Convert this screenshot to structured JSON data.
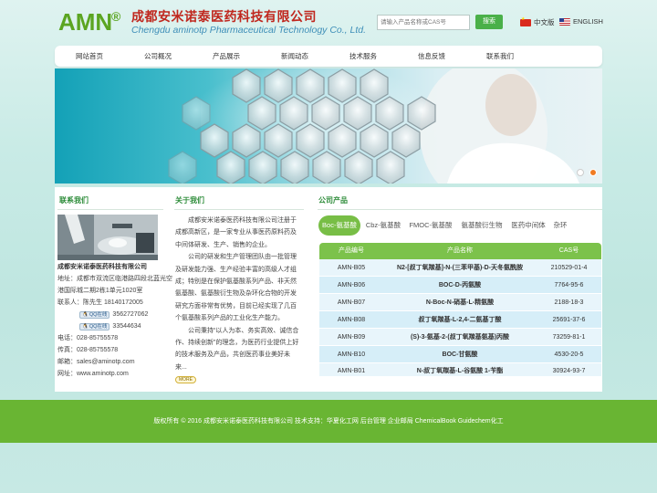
{
  "brand": {
    "logo_text": "AMN",
    "logo_mark": "®",
    "company_cn": "成都安米诺泰医药科技有限公司",
    "company_en": "Chengdu aminotp Pharmaceutical Technology Co., Ltd."
  },
  "search": {
    "placeholder": "请输入产品名称或CAS号",
    "button_label": "搜索"
  },
  "languages": [
    {
      "label": "中文版",
      "flag": "china-flag-icon"
    },
    {
      "label": "ENGLISH",
      "flag": "usa-flag-icon"
    }
  ],
  "nav": [
    "网站首页",
    "公司概况",
    "产品展示",
    "新闻动态",
    "技术服务",
    "信息反馈",
    "联系我们"
  ],
  "contact": {
    "title": "联系我们",
    "company": "成都安米诺泰医药科技有限公司",
    "address": "地址：成都市双流区临港路四段北蓝光空港国际城二期2栋1单元1020室",
    "person": "联系人：陈先生 18140172005",
    "qq_badge": "QQ在线",
    "qq_numbers": [
      "3562727062",
      "33544634"
    ],
    "phone": "电话：028-85755578",
    "fax": "传真：028-85755578",
    "email": "邮箱：sales@aminotp.com",
    "website": "网址：www.aminotp.com"
  },
  "about": {
    "title": "关于我们",
    "p1": "成都安米诺泰医药科技有限公司注册于成都高新区，是一家专业从事医药原料药及中间体研发、生产、销售的企业。",
    "p2": "公司的研发和生产管理团队由一批管理及研发能力强、生产经验丰富的高级人才组成；特别是在保护氨基酸系列产品、非天然氨基酸、氨基酸衍生物及杂环化合物的开发研究方面非常有优势，目前已经实现了几百个氨基酸系列产品的工业化生产能力。",
    "p3": "公司秉持“以人为本、务实高效、诚信合作、持续创新”的理念，为医药行业提供上好的技术服务及产品，共创医药事业美好未来...",
    "more_label": "MORE"
  },
  "products": {
    "title": "公司产品",
    "tabs": [
      "Boc-氨基酸",
      "Cbz-氨基酸",
      "FMOC-氨基酸",
      "氨基酸衍生物",
      "医药中间体",
      "杂环"
    ],
    "columns": [
      "产品编号",
      "产品名称",
      "CAS号"
    ],
    "rows": [
      {
        "code": "AMN-B05",
        "name": "N2-[叔丁氧羰基]-N-(三苯甲基)-D-天冬氨酰胺",
        "cas": "210529-01-4"
      },
      {
        "code": "AMN-B06",
        "name": "BOC-D-丙氨酸",
        "cas": "7764-95-6"
      },
      {
        "code": "AMN-B07",
        "name": "N-Boc-N-硝基-L-精氨酸",
        "cas": "2188-18-3"
      },
      {
        "code": "AMN-B08",
        "name": "叔丁氧羰基-L-2,4-二氨基丁酸",
        "cas": "25691-37-6"
      },
      {
        "code": "AMN-B09",
        "name": "(S)-3-氨基-2-(叔丁氧羰基氨基)丙酸",
        "cas": "73259-81-1"
      },
      {
        "code": "AMN-B10",
        "name": "BOC-甘氨酸",
        "cas": "4530-20-5"
      },
      {
        "code": "AMN-B01",
        "name": "N-叔丁氧羰基-L-谷氨酸 1-苄酯",
        "cas": "30924-93-7"
      }
    ]
  },
  "footer": {
    "text": "版权所有 © 2016 成都安米诺泰医药科技有限公司 技术支持：华夏化工网 后台管理 企业邮局 ChemicalBook Guidechem化工"
  },
  "colors": {
    "brand_green": "#5ba521",
    "brand_red": "#c0271e",
    "nav_bg": "#ffffff",
    "accent_green": "#78be46",
    "footer_green": "#69b533",
    "table_row_blue": "#d6eef8"
  }
}
